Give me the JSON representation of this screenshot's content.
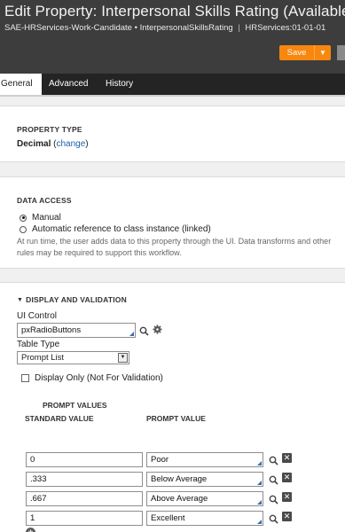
{
  "header": {
    "title": "Edit  Property:  Interpersonal Skills Rating  (Available)",
    "class_name": "SAE-HRServices-Work-Candidate",
    "bullet": "•",
    "property_name": "InterpersonalSkillsRating",
    "separator": "|",
    "ruleset": "HRServices:01-01-01",
    "save_label": "Save",
    "save_arrow": "▼"
  },
  "tabs": [
    {
      "label": "General"
    },
    {
      "label": "Advanced"
    },
    {
      "label": "History"
    }
  ],
  "property_type": {
    "heading": "PROPERTY TYPE",
    "value": "Decimal",
    "open_paren": " (",
    "change_label": "change",
    "close_paren": ")"
  },
  "data_access": {
    "heading": "DATA ACCESS",
    "options": [
      {
        "label": "Manual",
        "selected": true
      },
      {
        "label": "Automatic reference to class instance (linked)",
        "selected": false
      }
    ],
    "help_text": "At run time, the user adds data to this property through the UI. Data transforms and other rules may be required to support this workflow."
  },
  "display_validation": {
    "heading": "DISPLAY AND VALIDATION",
    "collapse_icon": "triangle-down",
    "ui_control_label": "UI Control",
    "ui_control_value": "pxRadioButtons",
    "table_type_label": "Table Type",
    "table_type_value": "Prompt List",
    "display_only_label": "Display Only (Not For Validation)",
    "display_only_checked": false,
    "prompt_values_heading": "PROMPT VALUES",
    "col_standard": "STANDARD VALUE",
    "col_prompt": "PROMPT VALUE",
    "rows": [
      {
        "standard": "0",
        "prompt": "Poor"
      },
      {
        "standard": ".333",
        "prompt": "Below Average"
      },
      {
        "standard": ".667",
        "prompt": "Above Average"
      },
      {
        "standard": "1",
        "prompt": "Excellent"
      }
    ]
  },
  "colors": {
    "header_bg": "#3d3d3d",
    "tab_bar_bg": "#242424",
    "save_button": "#f7870e",
    "link": "#1c5fa8",
    "field_corner": "#3a6ea5"
  }
}
